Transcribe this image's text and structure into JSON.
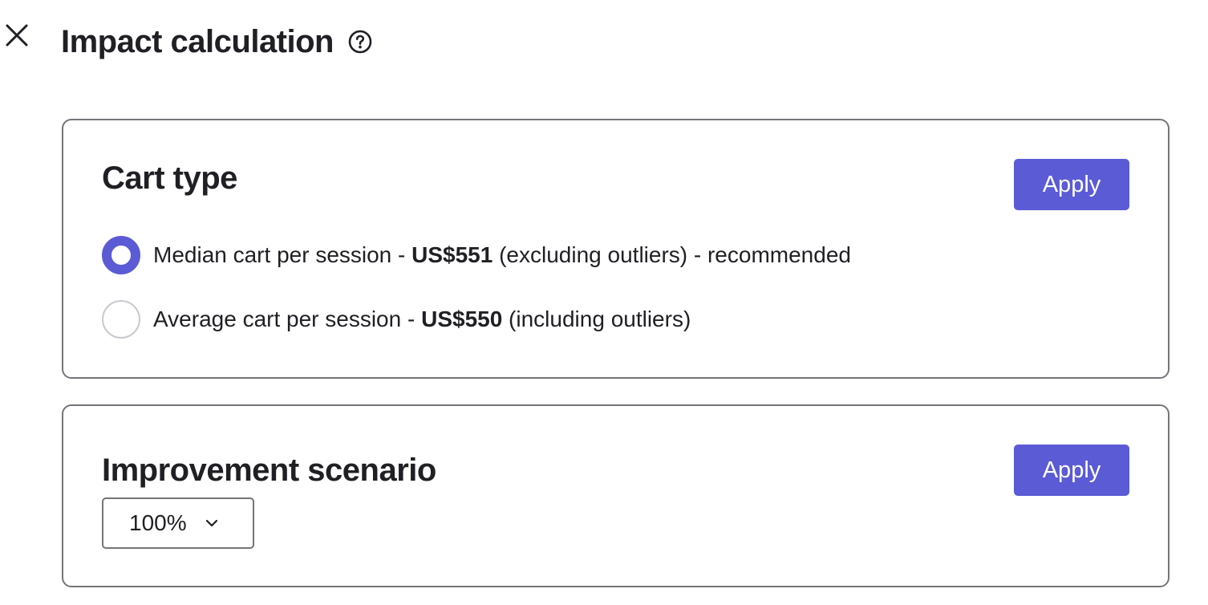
{
  "header": {
    "title": "Impact calculation",
    "close_icon": "close-icon",
    "help_icon": "help-circle-icon"
  },
  "cart_type": {
    "heading": "Cart type",
    "apply_label": "Apply",
    "options": [
      {
        "prefix": "Median cart per session - ",
        "amount": "US$551",
        "suffix": " (excluding outliers) - recommended",
        "selected": true
      },
      {
        "prefix": "Average cart per session - ",
        "amount": "US$550",
        "suffix": " (including outliers)",
        "selected": false
      }
    ]
  },
  "improvement": {
    "heading": "Improvement scenario",
    "apply_label": "Apply",
    "selected_value": "100%",
    "chevron_icon": "chevron-down-icon"
  },
  "colors": {
    "accent": "#5b5bd6",
    "border": "#75747a",
    "text": "#1f1f24"
  }
}
